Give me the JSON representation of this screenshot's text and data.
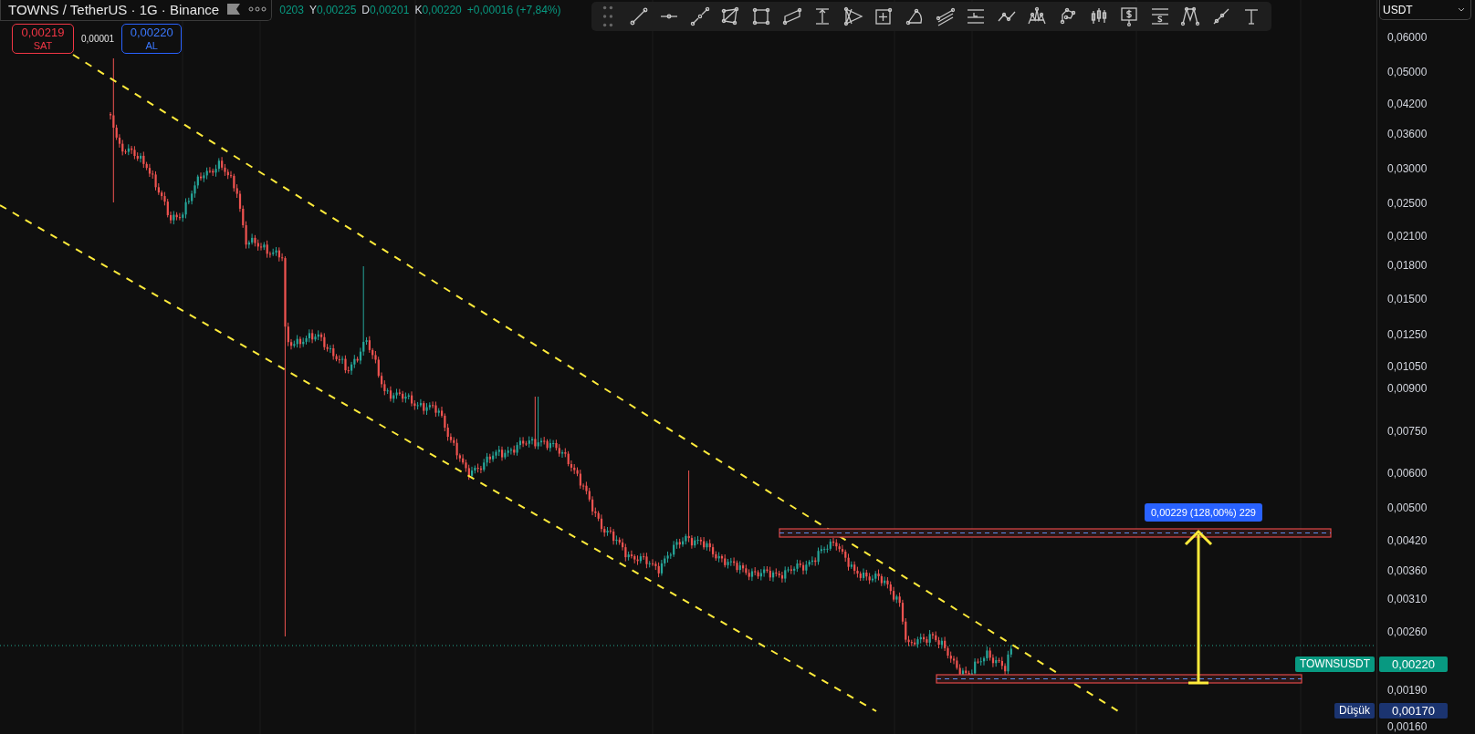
{
  "legend": {
    "symbol": "TOWNS / TetherUS · 1G · Binance",
    "ohlc": [
      {
        "value": "0203"
      },
      {
        "label": "Y",
        "value": "0,00225"
      },
      {
        "label": "D",
        "value": "0,00201"
      },
      {
        "label": "K",
        "value": "0,00220"
      }
    ],
    "change": "+0,00016 (+7,84%)"
  },
  "trade": {
    "sell": {
      "price": "0,00219",
      "label": "SAT"
    },
    "spread": "0,00001",
    "buy": {
      "price": "0,00220",
      "label": "AL"
    }
  },
  "measure_label": "0,00229 (128,00%) 229",
  "currency_select": {
    "value": "USDT"
  },
  "price_axis": {
    "ticks": [
      "0,06000",
      "0,05000",
      "0,04200",
      "0,03600",
      "0,03000",
      "0,02500",
      "0,02100",
      "0,01800",
      "0,01500",
      "0,01250",
      "0,01050",
      "0,00900",
      "0,00750",
      "0,00600",
      "0,00500",
      "0,00420",
      "0,00360",
      "0,00310",
      "0,00260",
      "0,00190",
      "0,00160"
    ]
  },
  "price_labels": [
    {
      "kind": "symbol",
      "name": "TOWNSUSDT",
      "price": "0,00220"
    },
    {
      "kind": "low",
      "name": "Düşük",
      "price": "0,00170"
    }
  ]
}
